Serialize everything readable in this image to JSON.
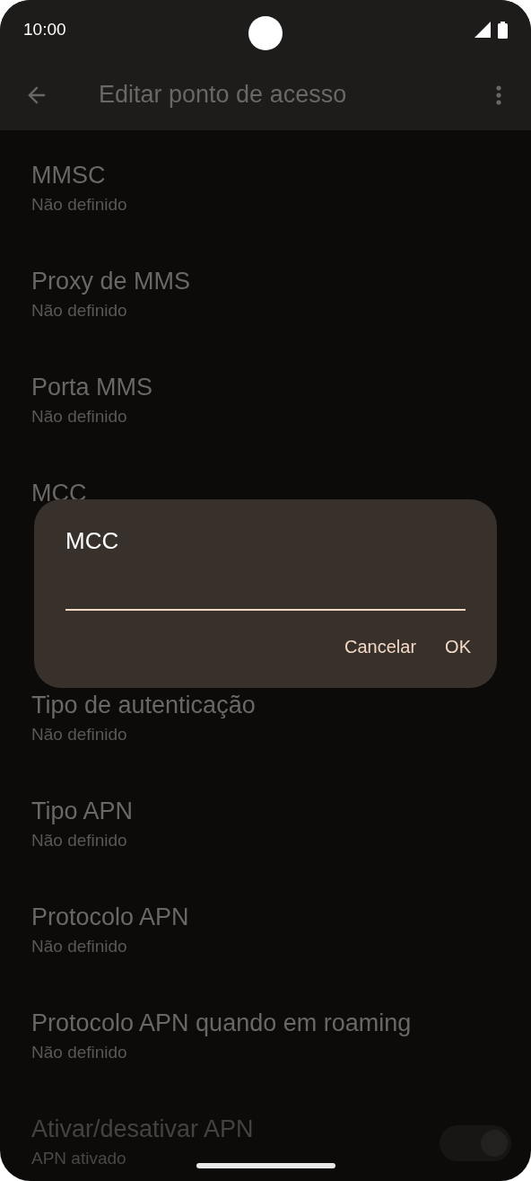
{
  "status_bar": {
    "time": "10:00"
  },
  "app_bar": {
    "title": "Editar ponto de acesso"
  },
  "rows": [
    {
      "kind": "text",
      "title": "MMSC",
      "summary": "Não definido",
      "disabled": false
    },
    {
      "kind": "text",
      "title": "Proxy de MMS",
      "summary": "Não definido",
      "disabled": false
    },
    {
      "kind": "text",
      "title": "Porta MMS",
      "summary": "Não definido",
      "disabled": false
    },
    {
      "kind": "text",
      "title": "MCC",
      "disabled": false
    },
    {
      "kind": "covered"
    },
    {
      "kind": "text",
      "title": "Tipo de autenticação",
      "summary": "Não definido",
      "disabled": false
    },
    {
      "kind": "text",
      "title": "Tipo APN",
      "summary": "Não definido",
      "disabled": false
    },
    {
      "kind": "text",
      "title": "Protocolo APN",
      "summary": "Não definido",
      "disabled": false
    },
    {
      "kind": "text",
      "title": "Protocolo APN quando em roaming",
      "summary": "Não definido",
      "disabled": false
    },
    {
      "kind": "switch",
      "title": "Ativar/desativar APN",
      "summary": "APN ativado",
      "disabled": true,
      "on": true
    }
  ],
  "dialog": {
    "title": "MCC",
    "buttons": [
      "Cancelar",
      "OK"
    ]
  }
}
